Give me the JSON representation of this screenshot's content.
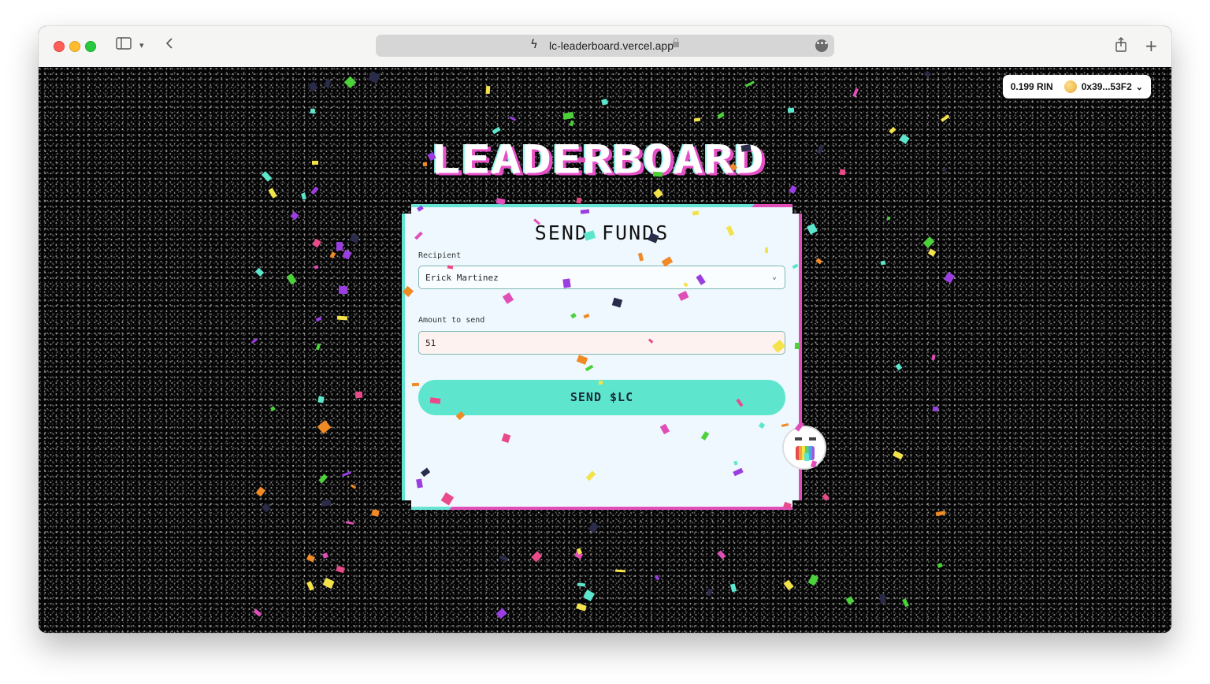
{
  "browser": {
    "url": "lc-leaderboard.vercel.app"
  },
  "wallet": {
    "balance": "0.199 RIN",
    "address": "0x39...53F2"
  },
  "page": {
    "title": "LEADERBOARD"
  },
  "form": {
    "heading": "SEND FUNDS",
    "recipient_label": "Recipient",
    "recipient_value": "Erick Martinez",
    "amount_label": "Amount to send",
    "amount_value": "51",
    "submit_label": "SEND $LC"
  },
  "colors": {
    "accent_teal": "#5de6cd",
    "accent_pink": "#e04fb8",
    "card_bg": "#eef8fe"
  },
  "icons": {
    "bolt": "bolt-icon",
    "lock": "lock-icon",
    "more": "more-icon",
    "share": "share-icon",
    "new_tab": "plus-icon",
    "sidebar": "sidebar-icon",
    "back": "back-icon",
    "chevron": "chevron-down-icon"
  }
}
